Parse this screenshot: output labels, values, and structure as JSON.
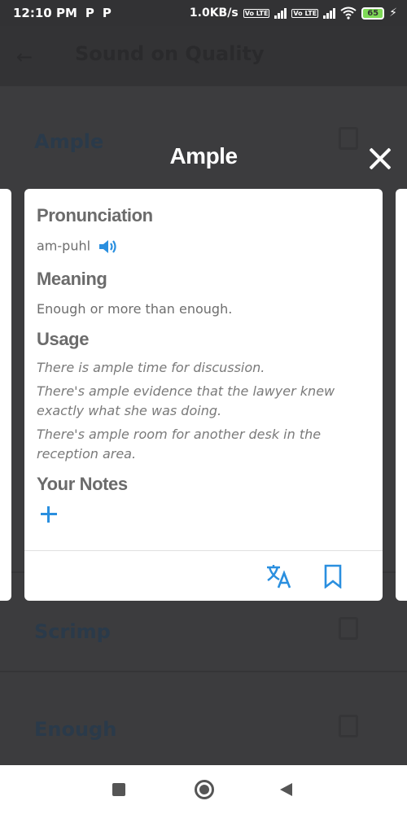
{
  "status_bar": {
    "time": "12:10 PM",
    "app_icons": [
      "P",
      "P"
    ],
    "speed": "1.0KB/s",
    "volte1": "Vo LTE",
    "volte2": "Vo LTE",
    "battery": "65"
  },
  "background": {
    "title": "Sound on Quality",
    "words": [
      "Ample",
      "Scrimp",
      "Enough"
    ]
  },
  "modal": {
    "title": "Ample",
    "pronunciation_heading": "Pronunciation",
    "pronunciation": "am-puhl",
    "meaning_heading": "Meaning",
    "meaning": "Enough or more than enough.",
    "usage_heading": "Usage",
    "usage": [
      "There is ample time for discussion.",
      "There's ample evidence that the lawyer knew exactly what she was doing.",
      "There's ample room for another desk in the reception area."
    ],
    "notes_heading": "Your Notes"
  },
  "colors": {
    "accent": "#2a8fdf",
    "overlay": "#3c3c3e",
    "heading": "#6b6b6b"
  }
}
